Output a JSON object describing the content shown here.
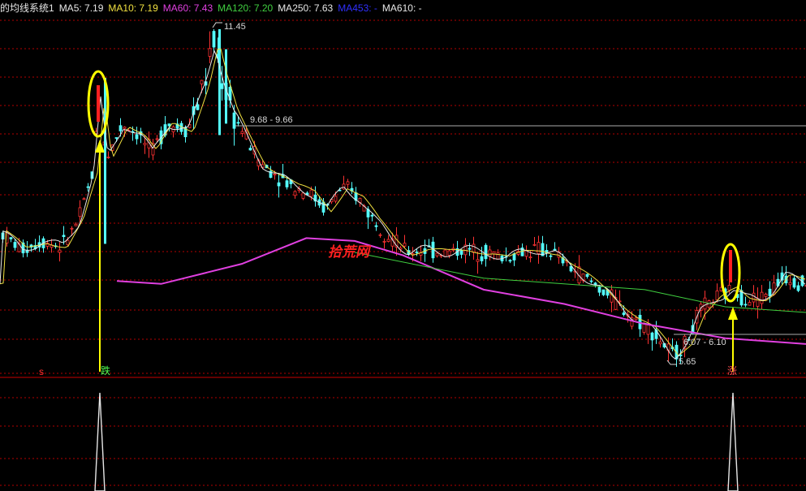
{
  "legend": {
    "title": "的均线系统1",
    "items": [
      {
        "label": "MA5: 7.19",
        "color": "#e6e6e6"
      },
      {
        "label": "MA10: 7.19",
        "color": "#f0e040"
      },
      {
        "label": "MA60: 7.43",
        "color": "#e040e0"
      },
      {
        "label": "MA120: 7.20",
        "color": "#40d040"
      },
      {
        "label": "MA250: 7.63",
        "color": "#e6e6e6"
      },
      {
        "label": "MA453: -",
        "color": "#3030ff"
      },
      {
        "label": "MA610: -",
        "color": "#e6e6e6"
      }
    ]
  },
  "annotations": {
    "high": "11.45",
    "low": "5.65",
    "range_upper": "9.68 - 9.66",
    "range_lower": "6.07 - 6.10",
    "watermark": "拾荒网",
    "signal_left": "跌",
    "signal_right": "涨",
    "signal_mark": "s"
  },
  "colors": {
    "up": "#ff3232",
    "down": "#54ffff",
    "grid": "#b40000",
    "ma60": "#e040e0",
    "ma120": "#40d040",
    "ma10": "#f0e040",
    "ma5": "#e6e6e6",
    "signal": "#ffff00"
  },
  "chart_data": {
    "type": "candlestick",
    "series": [
      {
        "name": "MA60",
        "color": "#e040e0",
        "points": [
          [
            0.145,
            7.05
          ],
          [
            0.2,
            7.0
          ],
          [
            0.3,
            7.35
          ],
          [
            0.38,
            7.8
          ],
          [
            0.44,
            7.75
          ],
          [
            0.5,
            7.5
          ],
          [
            0.6,
            6.9
          ],
          [
            0.7,
            6.65
          ],
          [
            0.8,
            6.3
          ],
          [
            0.9,
            6.05
          ],
          [
            1.0,
            5.95
          ]
        ]
      },
      {
        "name": "MA120",
        "color": "#40d040",
        "points": [
          [
            0.44,
            7.55
          ],
          [
            0.6,
            7.1
          ],
          [
            0.8,
            6.9
          ],
          [
            0.9,
            6.6
          ],
          [
            1.0,
            6.5
          ]
        ]
      }
    ],
    "markers": [
      {
        "label": "11.45",
        "value": 11.45
      },
      {
        "label": "5.65",
        "value": 5.65
      }
    ],
    "signals": [
      {
        "label": "跌",
        "position": 0.125
      },
      {
        "label": "涨",
        "position": 0.905
      }
    ]
  }
}
